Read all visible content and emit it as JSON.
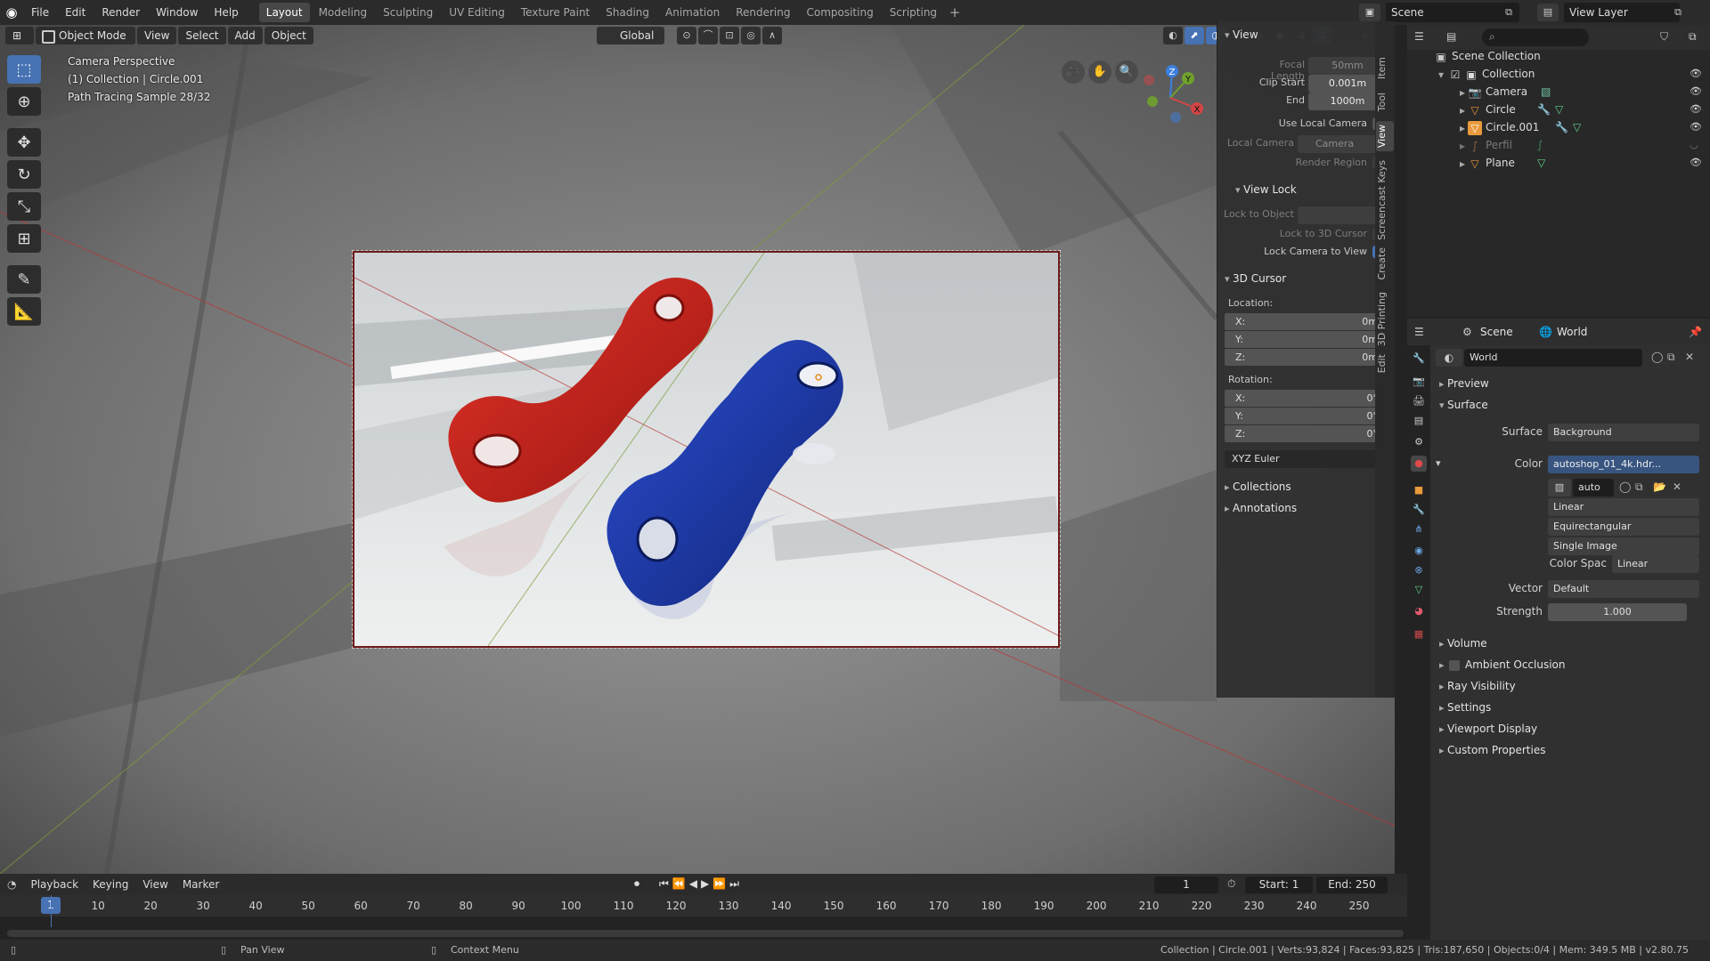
{
  "top_menu": {
    "items": [
      "File",
      "Edit",
      "Render",
      "Window",
      "Help"
    ],
    "workspaces": [
      "Layout",
      "Modeling",
      "Sculpting",
      "UV Editing",
      "Texture Paint",
      "Shading",
      "Animation",
      "Rendering",
      "Compositing",
      "Scripting"
    ],
    "active_workspace": "Layout",
    "add_tab": "+",
    "scene": "Scene",
    "view_layer": "View Layer"
  },
  "viewport": {
    "mode": "Object Mode",
    "menus": [
      "View",
      "Select",
      "Add",
      "Object"
    ],
    "transform_orientation": "Global",
    "overlay_lines": [
      "Camera Perspective",
      "(1) Collection | Circle.001",
      "Path Tracing Sample 28/32"
    ],
    "axis_labels": {
      "x": "X",
      "y": "Y",
      "z": "Z"
    }
  },
  "npanel": {
    "tabs": [
      "Item",
      "Tool",
      "View",
      "Screencast Keys",
      "Create",
      "3D Printing",
      "Edit"
    ],
    "active_tab": "View",
    "view_section": {
      "title": "View",
      "focal_length_label": "Focal Length",
      "focal_length": "50mm",
      "clip_start_label": "Clip Start",
      "clip_start": "0.001m",
      "end_label": "End",
      "end": "1000m",
      "use_local_camera": "Use Local Camera",
      "local_camera_label": "Local Camera",
      "local_camera": "Camera",
      "render_region": "Render Region"
    },
    "view_lock": {
      "title": "View Lock",
      "lock_to_object": "Lock to Object",
      "lock_to_cursor": "Lock to 3D Cursor",
      "lock_camera": "Lock Camera to View"
    },
    "cursor": {
      "title": "3D Cursor",
      "location_label": "Location:",
      "loc": [
        {
          "k": "X:",
          "v": "0m"
        },
        {
          "k": "Y:",
          "v": "0m"
        },
        {
          "k": "Z:",
          "v": "0m"
        }
      ],
      "rotation_label": "Rotation:",
      "rot": [
        {
          "k": "X:",
          "v": "0°"
        },
        {
          "k": "Y:",
          "v": "0°"
        },
        {
          "k": "Z:",
          "v": "0°"
        }
      ],
      "rotation_mode": "XYZ Euler"
    },
    "collections": "Collections",
    "annotations": "Annotations"
  },
  "outliner": {
    "root": "Scene Collection",
    "collection": "Collection",
    "items": [
      "Camera",
      "Circle",
      "Circle.001",
      "Perfil",
      "Plane"
    ]
  },
  "properties": {
    "scene_label": "Scene",
    "world_label": "World",
    "world_name": "World",
    "sections": {
      "preview": "Preview",
      "surface": "Surface",
      "volume": "Volume",
      "ambient_occlusion": "Ambient Occlusion",
      "ray_visibility": "Ray Visibility",
      "settings": "Settings",
      "viewport_display": "Viewport Display",
      "custom_properties": "Custom Properties"
    },
    "surface_label": "Surface",
    "surface_value": "Background",
    "color_label": "Color",
    "color_value": "autoshop_01_4k.hdr...",
    "image_name": "auto",
    "interpolation": "Linear",
    "projection": "Equirectangular",
    "source": "Single Image",
    "color_space_label": "Color Spac",
    "color_space": "Linear",
    "vector_label": "Vector",
    "vector_value": "Default",
    "strength_label": "Strength",
    "strength_value": "1.000"
  },
  "timeline": {
    "menus": [
      "Playback",
      "Keying",
      "View",
      "Marker"
    ],
    "current_frame": "1",
    "start_label": "Start:",
    "start": "1",
    "end_label": "End:",
    "end": "250",
    "ruler": [
      "1",
      "10",
      "20",
      "30",
      "40",
      "50",
      "60",
      "70",
      "80",
      "90",
      "100",
      "110",
      "120",
      "130",
      "140",
      "150",
      "160",
      "170",
      "180",
      "190",
      "200",
      "210",
      "220",
      "230",
      "240",
      "250"
    ]
  },
  "status": {
    "pan": "Pan View",
    "context": "Context Menu",
    "stats": "Collection | Circle.001 | Verts:93,824 | Faces:93,825 | Tris:187,650 | Objects:0/4 | Mem: 349.5 MB | v2.80.75"
  },
  "colors": {
    "accent": "#4772b3",
    "red_part": "#c42018",
    "blue_part": "#1b3aa8"
  }
}
